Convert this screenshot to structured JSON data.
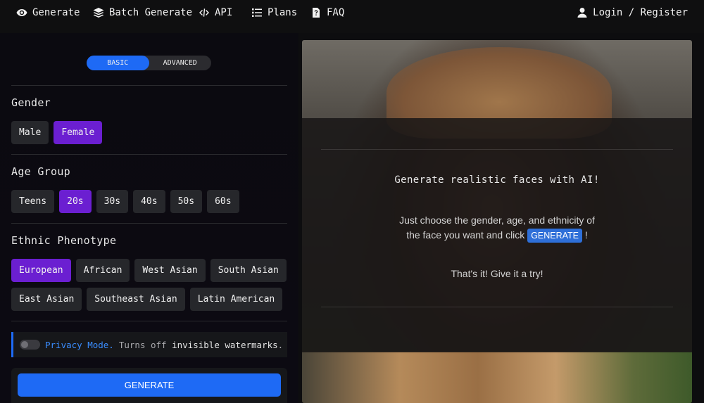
{
  "nav": {
    "generate": "Generate",
    "batch": "Batch Generate",
    "api": "API",
    "plans": "Plans",
    "faq": "FAQ",
    "login": "Login / Register"
  },
  "mode": {
    "basic": "BASIC",
    "advanced": "ADVANCED",
    "selected": "BASIC"
  },
  "gender": {
    "title": "Gender",
    "options": [
      "Male",
      "Female"
    ],
    "selected": "Female"
  },
  "age": {
    "title": "Age Group",
    "options": [
      "Teens",
      "20s",
      "30s",
      "40s",
      "50s",
      "60s"
    ],
    "selected": "20s"
  },
  "ethnicity": {
    "title": "Ethnic Phenotype",
    "row1": [
      "European",
      "African",
      "West Asian",
      "South Asian"
    ],
    "row2": [
      "East Asian",
      "Southeast Asian",
      "Latin American"
    ],
    "selected": "European"
  },
  "privacy": {
    "link": "Privacy Mode.",
    "desc": "Turns off",
    "strong": "invisible watermarks",
    "end": "."
  },
  "generate_button": "GENERATE",
  "overlay": {
    "heading": "Generate realistic faces with AI!",
    "text_before": "Just choose the gender, age, and ethnicity of the face you want and click",
    "badge": "GENERATE",
    "text_after": "!",
    "cta": "That's it! Give it a try!"
  },
  "colors": {
    "accent_blue": "#1e6af5",
    "selected_purple": "#6b1fd1",
    "chip_bg": "#26272b"
  }
}
